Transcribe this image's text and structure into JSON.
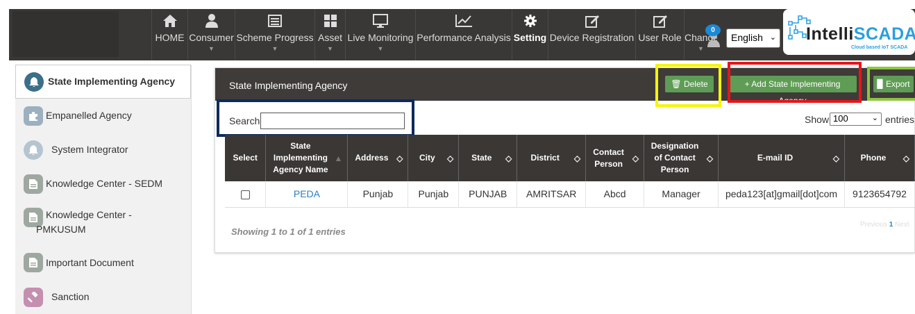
{
  "nav": {
    "items": [
      {
        "label": "HOME",
        "icon": "home-icon"
      },
      {
        "label": "Consumer",
        "icon": "user-icon"
      },
      {
        "label": "Scheme Progress",
        "icon": "list-icon"
      },
      {
        "label": "Asset",
        "icon": "grid-icon"
      },
      {
        "label": "Live Monitoring",
        "icon": "monitor-icon"
      },
      {
        "label": "Performance Analysis",
        "icon": "chart-icon"
      },
      {
        "label": "Setting",
        "icon": "gear-icon"
      },
      {
        "label": "Device Registration",
        "icon": "edit-icon"
      },
      {
        "label": "User Role",
        "icon": "edit-icon"
      },
      {
        "label": "Change",
        "icon": "user-icon"
      }
    ],
    "notification_count": "0",
    "language": "English",
    "brand_intelli": "Intelli",
    "brand_scada": "SCADA",
    "brand_tagline": "Cloud based IoT SCADA"
  },
  "sidebar": {
    "items": [
      {
        "label": "State Implementing Agency",
        "icon": "bell-icon"
      },
      {
        "label": "Empanelled Agency",
        "icon": "puzzle-icon"
      },
      {
        "label": "System Integrator",
        "icon": "bell-icon"
      },
      {
        "label": "Knowledge Center - SEDM",
        "icon": "document-icon"
      },
      {
        "label": "Knowledge Center -",
        "label2": "PMKUSUM",
        "icon": "document-icon"
      },
      {
        "label": "Important Document",
        "icon": "document-icon"
      },
      {
        "label": "Sanction",
        "icon": "gavel-icon"
      }
    ]
  },
  "panel": {
    "title": "State Implementing Agency",
    "delete_label": "Delete",
    "add_label": "+ Add State Implementing Agency",
    "export_label": "Export",
    "search_label": "Search:",
    "show_label": "Show",
    "show_value": "100",
    "entries_label": "entries",
    "info": "Showing 1 to 1 of 1 entries",
    "pager_prev": "Previous",
    "pager_page": "1",
    "pager_next": "Next"
  },
  "table": {
    "headers": [
      "Select",
      "State Implementing Agency Name",
      "Address",
      "City",
      "State",
      "District",
      "Contact Person",
      "Designation of Contact Person",
      "E-mail ID",
      "Phone"
    ],
    "rows": [
      [
        "",
        "PEDA",
        "Punjab",
        "Punjab",
        "PUNJAB",
        "AMRITSAR",
        "Abcd",
        "Manager",
        "peda123[at]gmail[dot]com",
        "9123654792"
      ]
    ]
  },
  "colors": {
    "header": "#3a3836",
    "button": "#5f9c55",
    "highlight_yellow": "#f5f50a",
    "highlight_red": "#e8151b",
    "highlight_green": "#8cc63f",
    "highlight_navy": "#0d2a5c"
  }
}
